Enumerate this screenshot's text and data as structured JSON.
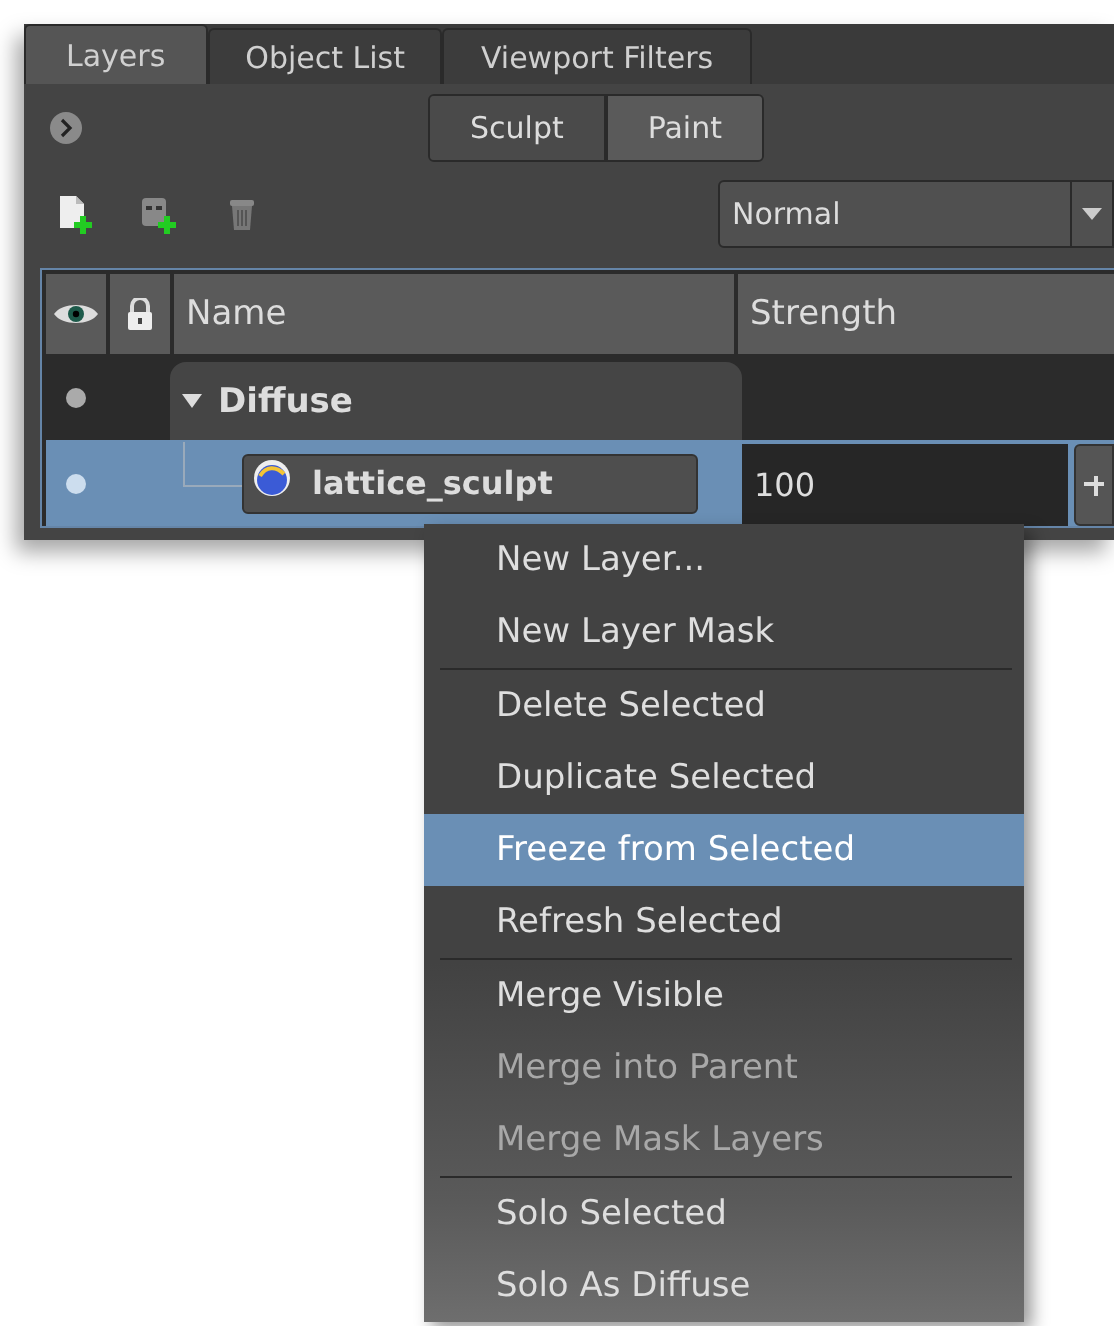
{
  "tabs": [
    {
      "label": "Layers",
      "selected": true
    },
    {
      "label": "Object List",
      "selected": false
    },
    {
      "label": "Viewport Filters",
      "selected": false
    }
  ],
  "mode_toggle": [
    {
      "label": "Sculpt",
      "selected": false
    },
    {
      "label": "Paint",
      "selected": true
    }
  ],
  "blend_mode": {
    "value": "Normal"
  },
  "table": {
    "columns": [
      "Name",
      "Strength"
    ],
    "rows": [
      {
        "kind": "group",
        "name": "Diffuse",
        "visible": true,
        "expanded": true,
        "selected": false
      },
      {
        "kind": "layer",
        "name": "lattice_sculpt",
        "strength": "100",
        "visible": true,
        "selected": true
      }
    ]
  },
  "context_menu": [
    {
      "label": "New Layer...",
      "disabled": false,
      "selected": false,
      "separator_after": false
    },
    {
      "label": "New Layer Mask",
      "disabled": false,
      "selected": false,
      "separator_after": true
    },
    {
      "label": "Delete Selected",
      "disabled": false,
      "selected": false,
      "separator_after": false
    },
    {
      "label": "Duplicate Selected",
      "disabled": false,
      "selected": false,
      "separator_after": false
    },
    {
      "label": "Freeze from Selected",
      "disabled": false,
      "selected": true,
      "separator_after": false
    },
    {
      "label": "Refresh Selected",
      "disabled": false,
      "selected": false,
      "separator_after": true
    },
    {
      "label": "Merge Visible",
      "disabled": false,
      "selected": false,
      "separator_after": false
    },
    {
      "label": "Merge into Parent",
      "disabled": true,
      "selected": false,
      "separator_after": false
    },
    {
      "label": "Merge Mask Layers",
      "disabled": true,
      "selected": false,
      "separator_after": true
    },
    {
      "label": "Solo Selected",
      "disabled": false,
      "selected": false,
      "separator_after": false
    },
    {
      "label": "Solo As Diffuse",
      "disabled": false,
      "selected": false,
      "separator_after": false
    }
  ]
}
